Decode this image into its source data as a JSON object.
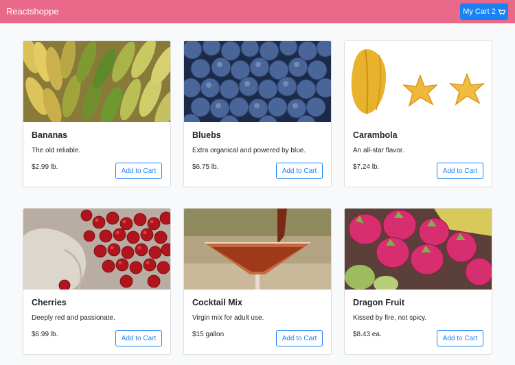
{
  "navbar": {
    "brand": "Reactshoppe",
    "cart_label": "My Cart 2",
    "colors": {
      "bar": "#e8698a",
      "button": "#1a82f5"
    },
    "cart_icon": "shopping-cart-icon"
  },
  "products": [
    {
      "name": "Bananas",
      "description": "The old reliable.",
      "price": "$2.99 lb.",
      "button": "Add to Cart"
    },
    {
      "name": "Bluebs",
      "description": "Extra organical and powered by blue.",
      "price": "$6.75 lb.",
      "button": "Add to Cart"
    },
    {
      "name": "Carambola",
      "description": "An all-star flavor.",
      "price": "$7.24 lb.",
      "button": "Add to Cart"
    },
    {
      "name": "Cherries",
      "description": "Deeply red and passionate.",
      "price": "$6.99 lb.",
      "button": "Add to Cart"
    },
    {
      "name": "Cocktail Mix",
      "description": "Virgin mix for adult use.",
      "price": "$15 gallon",
      "button": "Add to Cart"
    },
    {
      "name": "Dragon Fruit",
      "description": "Kissed by fire, not spicy.",
      "price": "$8.43 ea.",
      "button": "Add to Cart"
    }
  ]
}
